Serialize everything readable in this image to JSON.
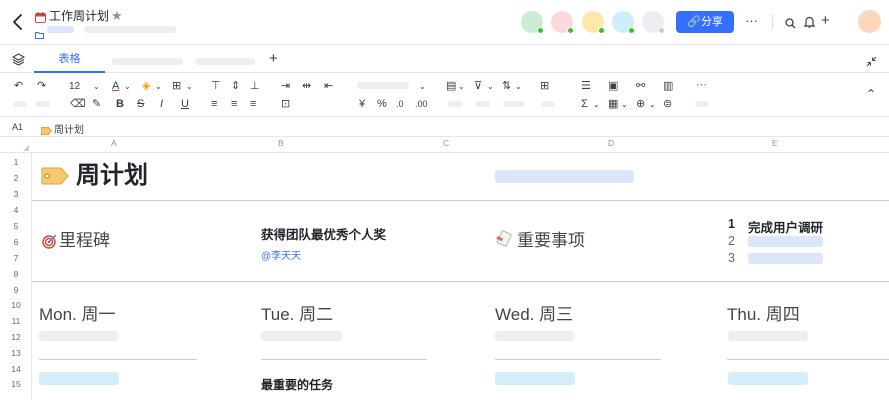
{
  "header": {
    "title": "工作周计划",
    "share_label": "分享",
    "more_label": "···"
  },
  "tabs": [
    {
      "label": "表格"
    }
  ],
  "toolbar": {
    "font_size": "12",
    "percent": "%",
    "currency": "¥",
    "sum": "Σ",
    "more": "···"
  },
  "formula": {
    "cell_ref": "A1",
    "content": "周计划"
  },
  "columns": [
    "A",
    "B",
    "C",
    "D",
    "E"
  ],
  "rows": [
    "1",
    "2",
    "3",
    "4",
    "5",
    "6",
    "7",
    "8",
    "9",
    "10",
    "11",
    "12",
    "13",
    "14",
    "15"
  ],
  "sheet": {
    "title": "周计划",
    "milestone_label": "里程碑",
    "team_award": "获得团队最优秀个人奖",
    "mention": "@李天天",
    "important_label": "重要事项",
    "important_items": [
      {
        "num": "1",
        "text": "完成用户调研"
      },
      {
        "num": "2",
        "text": ""
      },
      {
        "num": "3",
        "text": ""
      }
    ],
    "days": [
      "Mon. 周一",
      "Tue. 周二",
      "Wed. 周三",
      "Thu. 周四"
    ],
    "top_task_label": "最重要的任务"
  },
  "colors": {
    "accent": "#3370ff",
    "presence_dot": "#34c724"
  }
}
